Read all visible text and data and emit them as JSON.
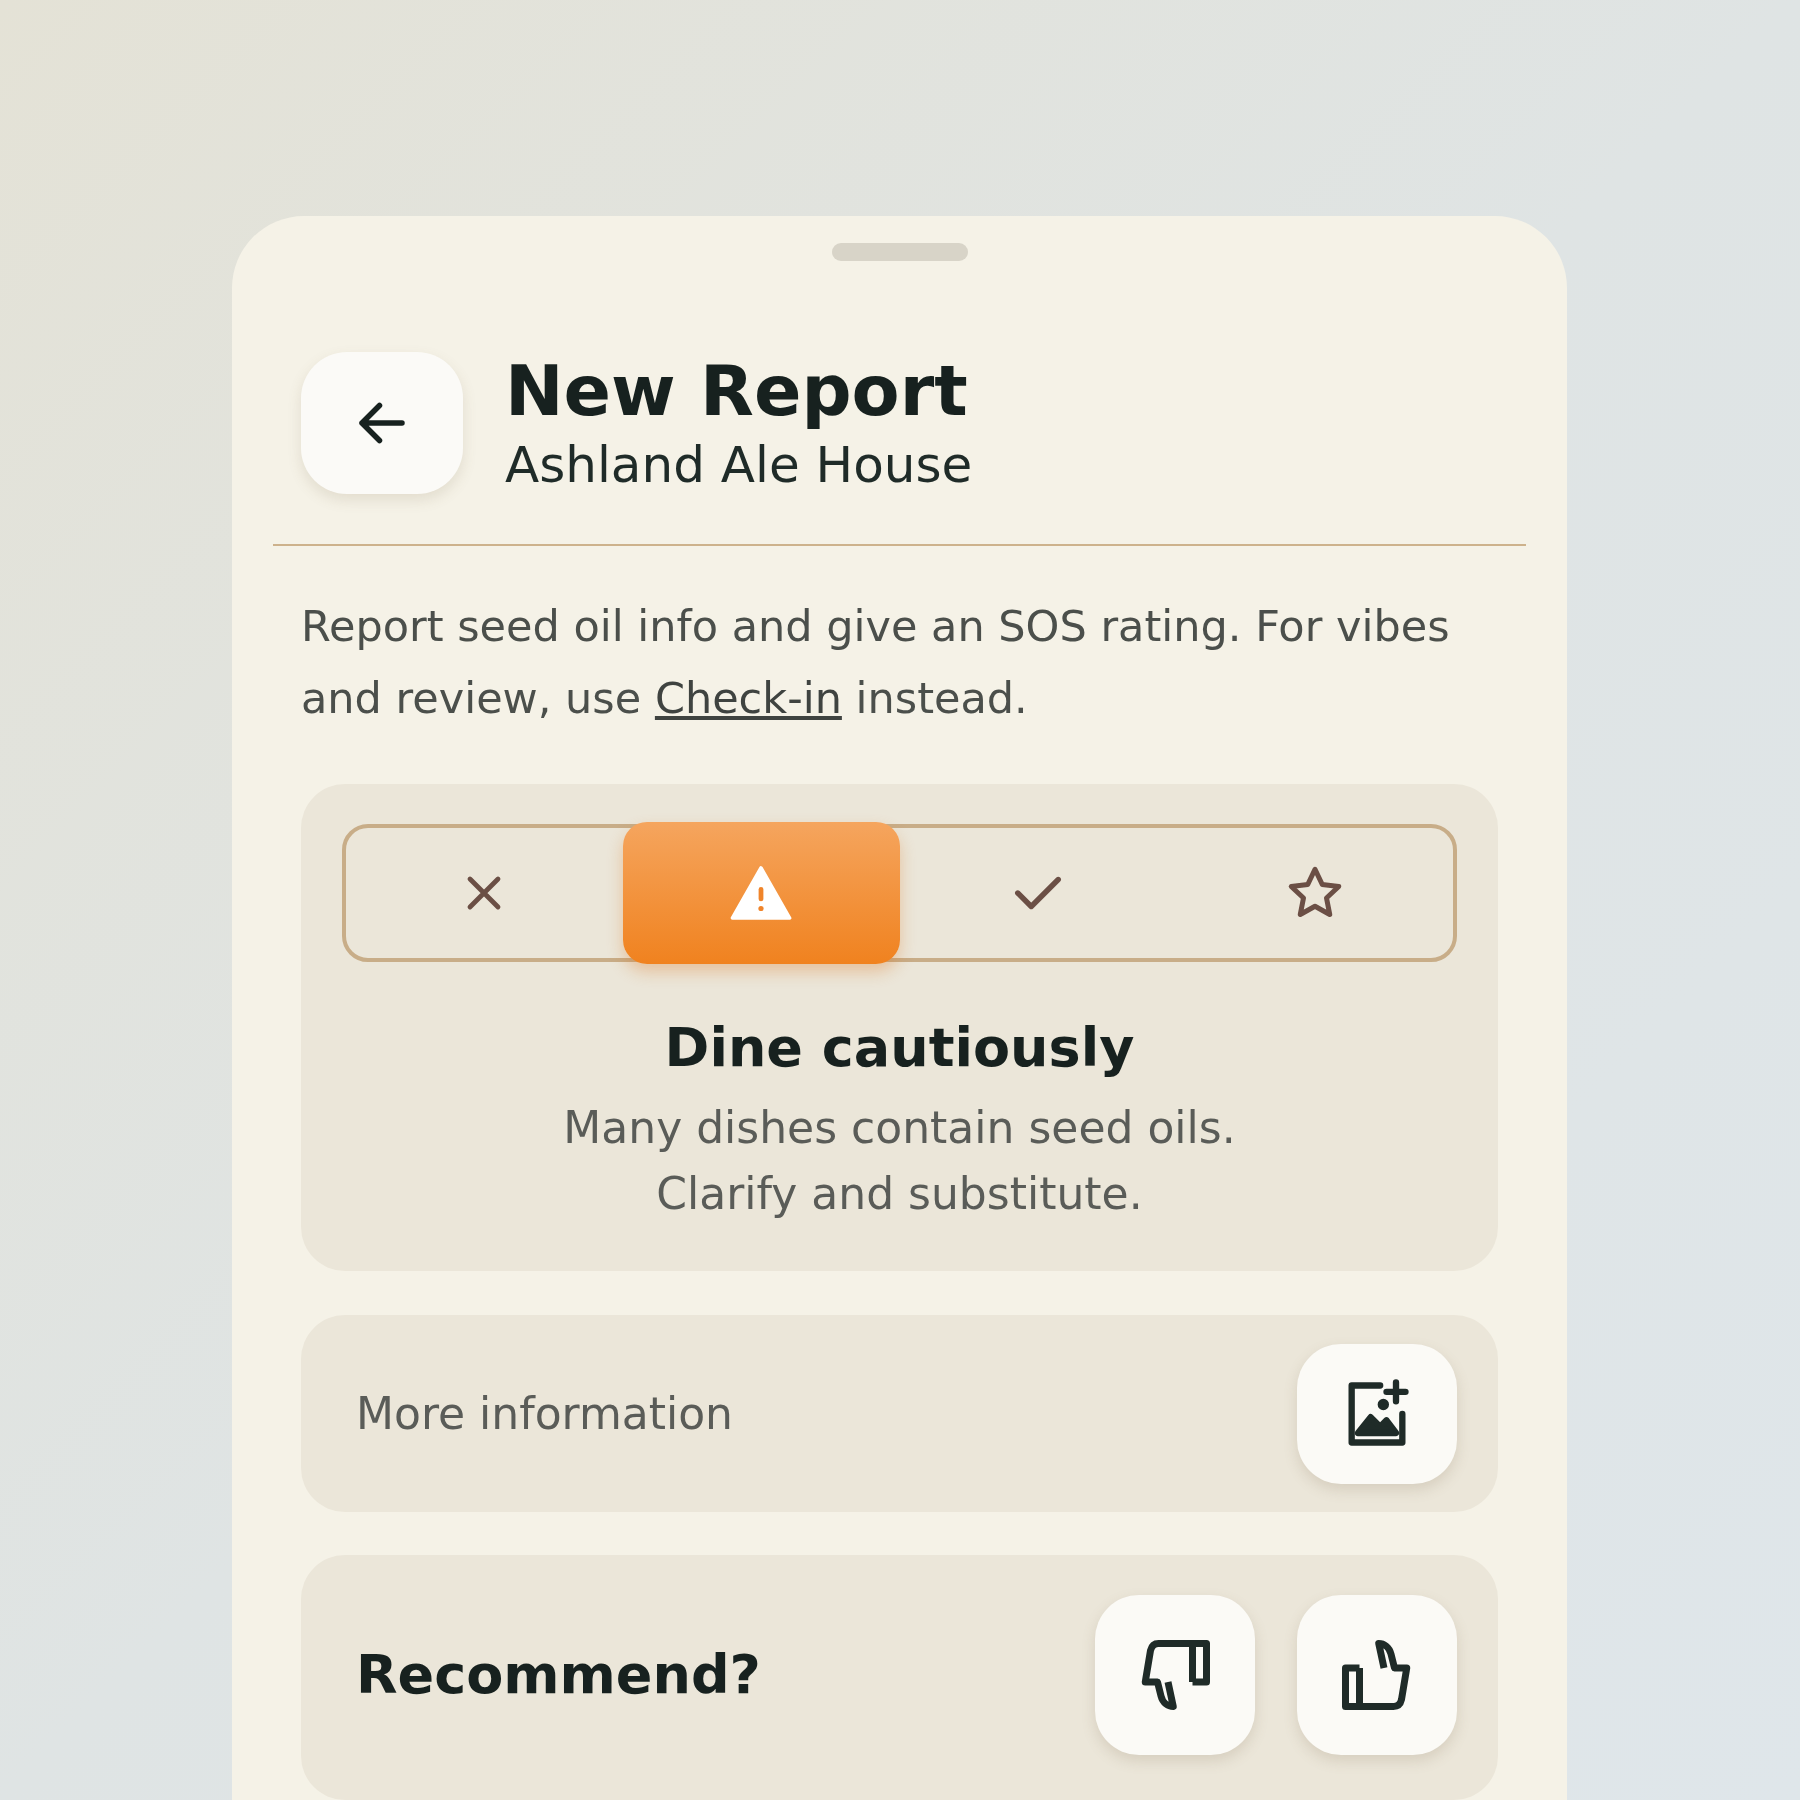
{
  "header": {
    "title": "New Report",
    "subtitle": "Ashland Ale House"
  },
  "intro": {
    "before": "Report seed oil info and give an SOS rating. For vibes and review, use ",
    "link": "Check-in",
    "after": " instead."
  },
  "rating": {
    "options": [
      {
        "kind": "avoid",
        "selected": false
      },
      {
        "kind": "caution",
        "selected": true
      },
      {
        "kind": "safe",
        "selected": false
      },
      {
        "kind": "star",
        "selected": false
      }
    ],
    "title": "Dine cautiously",
    "description": [
      "Many dishes contain seed oils.",
      "Clarify and substitute."
    ]
  },
  "more_info": {
    "label": "More information"
  },
  "recommend": {
    "label": "Recommend?"
  }
}
